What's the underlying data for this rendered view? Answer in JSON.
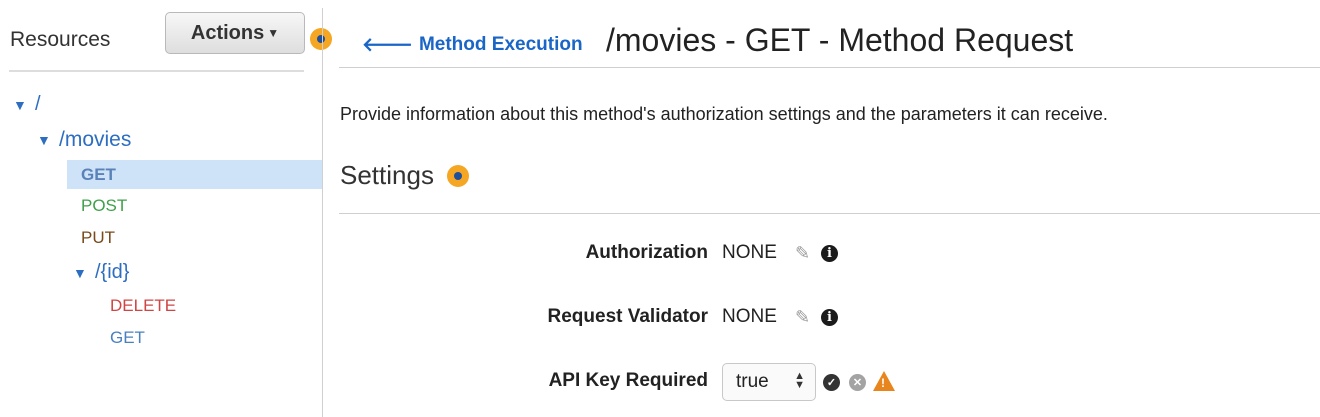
{
  "sidebar": {
    "title": "Resources",
    "actions_label": "Actions",
    "tree": {
      "root": "/",
      "movies": "/movies",
      "movies_methods": [
        "GET",
        "POST",
        "PUT"
      ],
      "id": "/{id}",
      "id_methods": [
        "DELETE",
        "GET"
      ]
    },
    "selected": "GET"
  },
  "header": {
    "back_link": "Method Execution",
    "title": "/movies - GET - Method Request"
  },
  "main": {
    "description": "Provide information about this method's authorization settings and the parameters it can receive.",
    "settings_heading": "Settings",
    "fields": {
      "authorization": {
        "label": "Authorization",
        "value": "NONE"
      },
      "request_validator": {
        "label": "Request Validator",
        "value": "NONE"
      },
      "api_key_required": {
        "label": "API Key Required",
        "value": "true"
      }
    }
  },
  "colors": {
    "accent_orange": "#f5a623",
    "link_blue": "#1a66c7",
    "selected_bg": "#cfe3f8",
    "post_green": "#3fa04a",
    "put_brown": "#7a4a1a",
    "delete_red": "#d04444",
    "warning_orange": "#e8851d"
  },
  "icons": [
    "back-arrow-icon",
    "pencil-icon",
    "info-icon",
    "check-icon",
    "cancel-icon",
    "warning-icon",
    "expand-triangle-icon",
    "hint-dot-icon"
  ]
}
